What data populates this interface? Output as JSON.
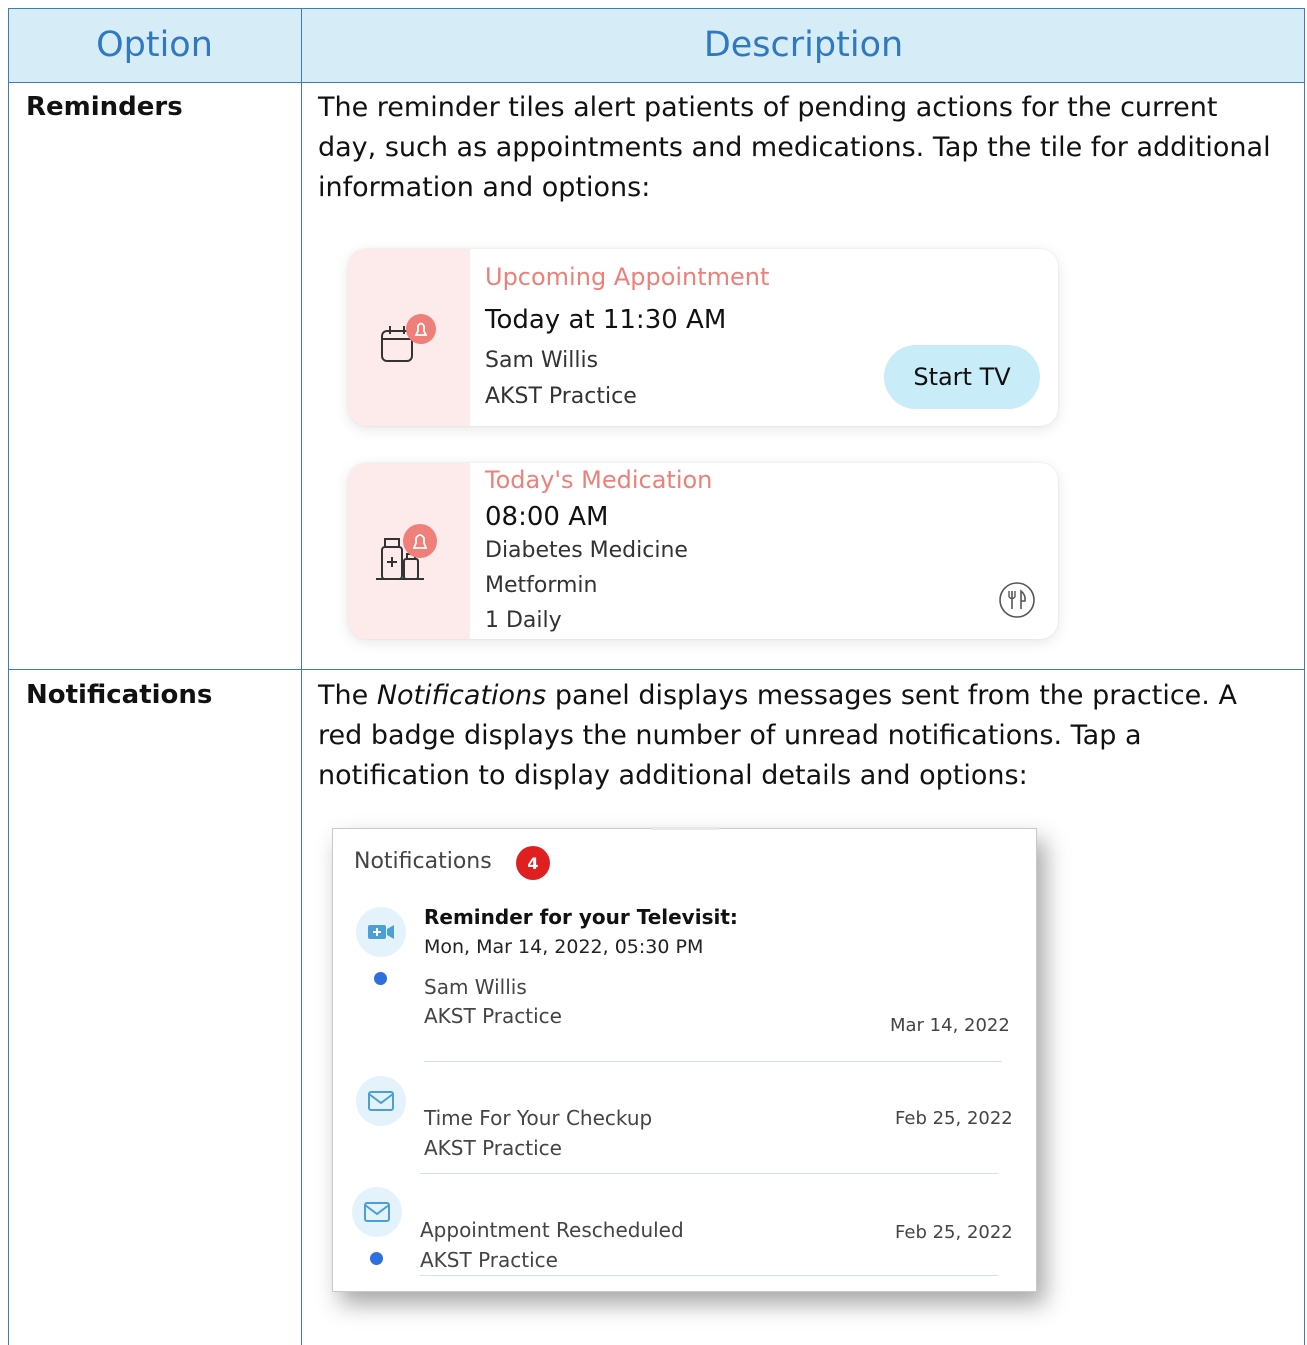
{
  "table": {
    "header": {
      "option": "Option",
      "description": "Description"
    },
    "rows": [
      {
        "option": "Reminders",
        "description": "The reminder tiles alert patients of pending actions for the current day, such as appointments and medications. Tap the tile for additional information and options:"
      },
      {
        "option": "Notifications",
        "description_prefix": "The ",
        "description_italic": "Notifications",
        "description_suffix": " panel displays messages sent from the practice. A red badge displays the number of unread notifications. Tap a notification to display additional details and options:"
      }
    ]
  },
  "appointment_card": {
    "title": "Upcoming Appointment",
    "time": "Today at 11:30 AM",
    "provider": "Sam Willis",
    "practice": "AKST Practice",
    "button_label": "Start TV",
    "icon": "calendar-bell-icon"
  },
  "medication_card": {
    "title": "Today's Medication",
    "time": "08:00 AM",
    "category": "Diabetes Medicine",
    "drug": "Metformin",
    "dose": "1 Daily",
    "icon": "medicine-bottles-bell-icon",
    "meal_icon": "fork-knife-icon"
  },
  "notifications": {
    "title": "Notifications",
    "badge_count": "4",
    "items": [
      {
        "icon": "video-icon",
        "title": "Reminder for your Televisit:",
        "datetime": "Mon, Mar 14, 2022, 05:30 PM",
        "provider": "Sam Willis",
        "practice": "AKST Practice",
        "date": "Mar 14, 2022",
        "unread": true
      },
      {
        "icon": "mail-icon",
        "title": "Time For Your Checkup",
        "practice": "AKST Practice",
        "date": "Feb 25, 2022",
        "unread": false
      },
      {
        "icon": "mail-icon",
        "title": "Appointment Rescheduled",
        "practice": "AKST Practice",
        "date": "Feb 25, 2022",
        "unread": true
      }
    ]
  },
  "colors": {
    "header_bg": "#d6ecf7",
    "header_text": "#2f79c2",
    "border": "#3a7cbf",
    "card_accent": "#ee7f79",
    "badge": "#e02020",
    "unread_dot": "#2e6fe0"
  }
}
